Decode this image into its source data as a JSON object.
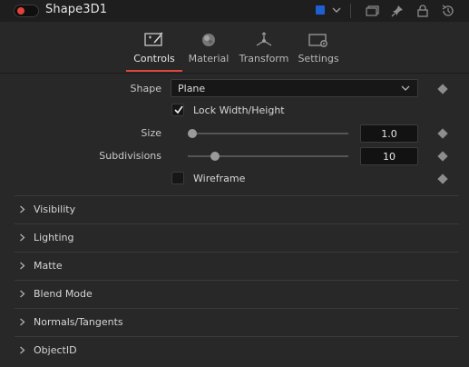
{
  "header": {
    "title": "Shape3D1",
    "color_chip": "#1f5fd4",
    "icons": [
      "power-toggle-icon",
      "color-chip",
      "chevron-down-icon",
      "windows-icon",
      "pin-icon",
      "lock-icon",
      "reset-icon"
    ]
  },
  "tabs": [
    {
      "label": "Controls",
      "icon": "controls-icon",
      "active": true
    },
    {
      "label": "Material",
      "icon": "material-icon",
      "active": false
    },
    {
      "label": "Transform",
      "icon": "transform-icon",
      "active": false
    },
    {
      "label": "Settings",
      "icon": "settings-icon",
      "active": false
    }
  ],
  "controls": {
    "shape": {
      "label": "Shape",
      "value": "Plane"
    },
    "lock": {
      "label": "Lock Width/Height",
      "checked": true
    },
    "size": {
      "label": "Size",
      "value": "1.0",
      "slider_position": 0.05
    },
    "subdivisions": {
      "label": "Subdivisions",
      "value": "10",
      "slider_position": 0.14
    },
    "wireframe": {
      "label": "Wireframe",
      "checked": false
    }
  },
  "sections": [
    {
      "label": "Visibility"
    },
    {
      "label": "Lighting"
    },
    {
      "label": "Matte"
    },
    {
      "label": "Blend Mode"
    },
    {
      "label": "Normals/Tangents"
    },
    {
      "label": "ObjectID"
    }
  ],
  "colors": {
    "accent": "#e2453c",
    "background": "#282828",
    "header": "#1e1e1e"
  }
}
